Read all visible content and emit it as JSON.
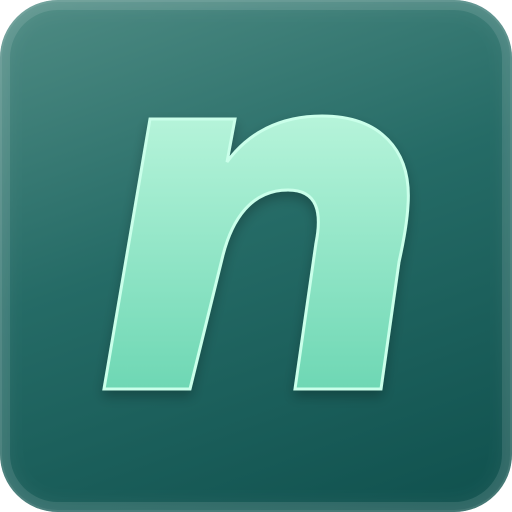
{
  "icon": {
    "glyph_name": "n-letter-icon",
    "colors": {
      "background_top": "#4f8c84",
      "background_mid": "#256b66",
      "background_bottom": "#0f504d",
      "glyph_fill_light": "#b6f4da",
      "glyph_fill_dark": "#6ed7b4",
      "glyph_stroke": "#caffea"
    }
  }
}
